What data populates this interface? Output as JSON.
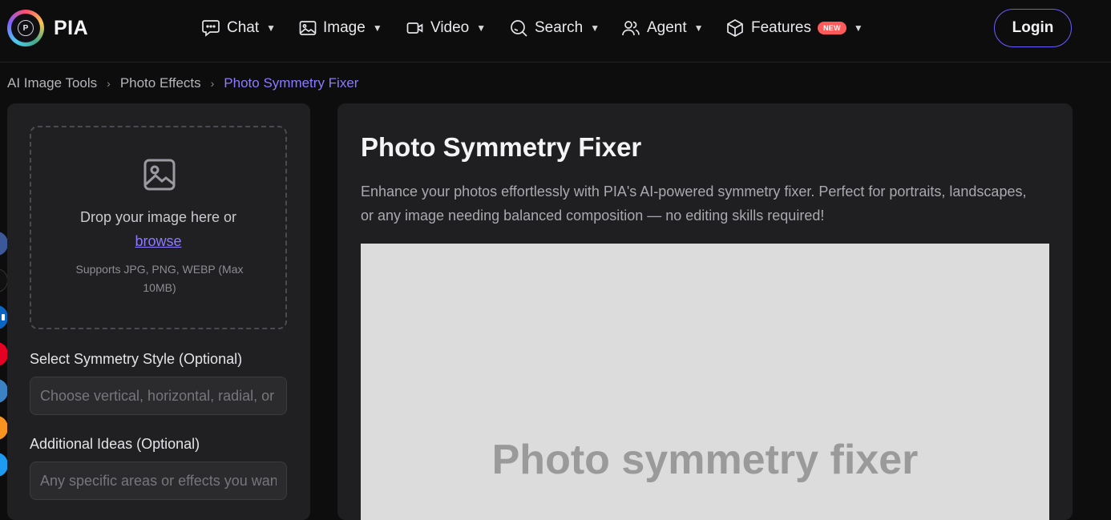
{
  "brand": {
    "name": "PIA",
    "mark_letter": "P"
  },
  "nav": {
    "items": [
      {
        "label": "Chat",
        "icon": "chat-bubble-icon"
      },
      {
        "label": "Image",
        "icon": "image-icon"
      },
      {
        "label": "Video",
        "icon": "video-camera-icon"
      },
      {
        "label": "Search",
        "icon": "search-icon"
      },
      {
        "label": "Agent",
        "icon": "agent-users-icon"
      },
      {
        "label": "Features",
        "icon": "cube-icon",
        "badge": "NEW"
      }
    ],
    "login_label": "Login"
  },
  "breadcrumb": {
    "items": [
      "AI Image Tools",
      "Photo Effects",
      "Photo Symmetry Fixer"
    ],
    "separator": "›"
  },
  "upload": {
    "icon": "image-upload-icon",
    "drop_text": "Drop your image here or",
    "browse_label": "browse",
    "hint": "Supports JPG, PNG, WEBP (Max 10MB)"
  },
  "form": {
    "style_label": "Select Symmetry Style (Optional)",
    "style_placeholder": "Choose vertical, horizontal, radial, or custom symmetry",
    "ideas_label": "Additional Ideas (Optional)",
    "ideas_placeholder": "Any specific areas or effects you want"
  },
  "social_colors": [
    "#3b5998",
    "#111111",
    "#0a66c2",
    "#e60023",
    "#3b82c4",
    "#f7931e",
    "#1d9bf0"
  ],
  "tool": {
    "title": "Photo Symmetry Fixer",
    "description": "Enhance your photos effortlessly with PIA's AI-powered symmetry fixer. Perfect for portraits, landscapes, or any image needing balanced composition — no editing skills required!",
    "preview_text": "Photo symmetry fixer"
  },
  "colors": {
    "accent": "#8b7bff",
    "login_border": "#6b5cff",
    "badge": "#ff5a5a"
  }
}
